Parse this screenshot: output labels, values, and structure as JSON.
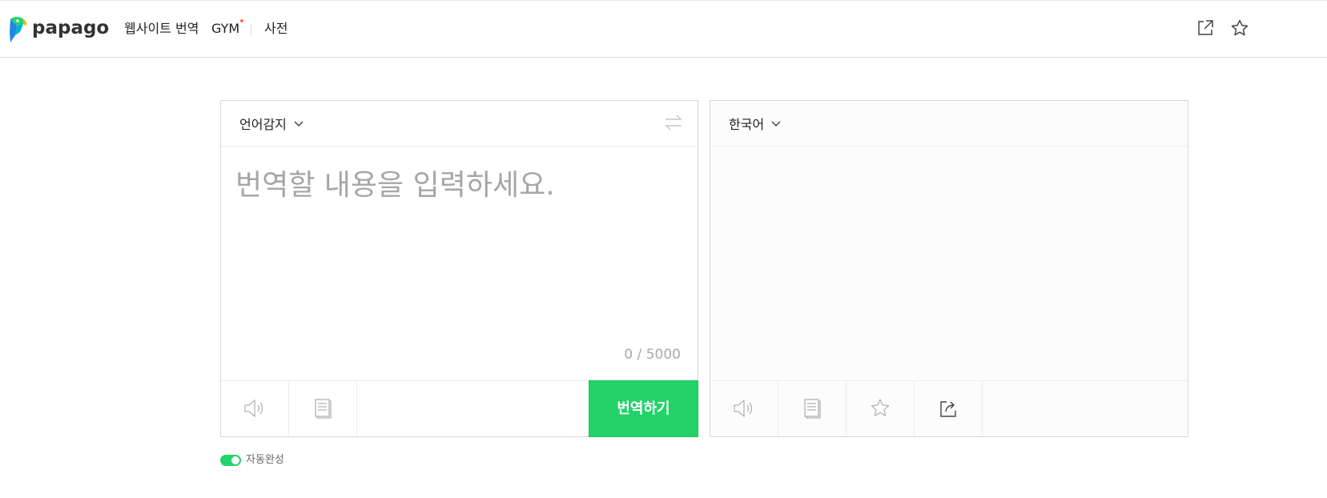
{
  "header": {
    "logo_text": "papago",
    "nav": [
      {
        "label": "웹사이트 번역"
      },
      {
        "label": "GYM",
        "has_new_dot": true
      },
      {
        "label": "사전"
      }
    ],
    "icons": [
      "external-window-icon",
      "star-icon"
    ]
  },
  "source": {
    "language": "언어감지",
    "input_value": "",
    "placeholder": "번역할 내용을 입력하세요.",
    "char_count": "0 / 5000",
    "translate_label": "번역하기",
    "footer_icons": [
      "speaker-icon",
      "handwriting-icon"
    ]
  },
  "target": {
    "language": "한국어",
    "footer_icons": [
      "speaker-icon",
      "copy-icon",
      "star-icon",
      "share-icon"
    ]
  },
  "autocomplete": {
    "label": "자동완성",
    "enabled": true
  },
  "colors": {
    "accent": "#23d36a",
    "nav_dot": "#ff6b3b",
    "placeholder": "#a6a6a6"
  }
}
